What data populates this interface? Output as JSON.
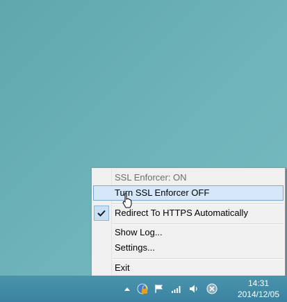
{
  "menu": {
    "items": [
      {
        "label": "SSL Enforcer: ON",
        "state": "disabled"
      },
      {
        "label": "Turn SSL Enforcer OFF",
        "state": "hover"
      },
      {
        "label": "Redirect To HTTPS Automatically",
        "state": "checked"
      },
      {
        "label": "Show Log...",
        "state": "normal"
      },
      {
        "label": "Settings...",
        "state": "normal"
      },
      {
        "label": "Exit",
        "state": "normal"
      }
    ]
  },
  "taskbar": {
    "tray_icons": [
      "chevron-up-icon",
      "ssl-enforcer-icon",
      "flag-icon",
      "network-icon",
      "volume-icon",
      "close-circle-icon"
    ],
    "time": "14:31",
    "date": "2014/12/05"
  },
  "colors": {
    "desktop": "#6db3b9",
    "taskbar": "#3f8ca8",
    "menu_bg": "#f0f0f0",
    "hover": "#d5e7f8"
  }
}
